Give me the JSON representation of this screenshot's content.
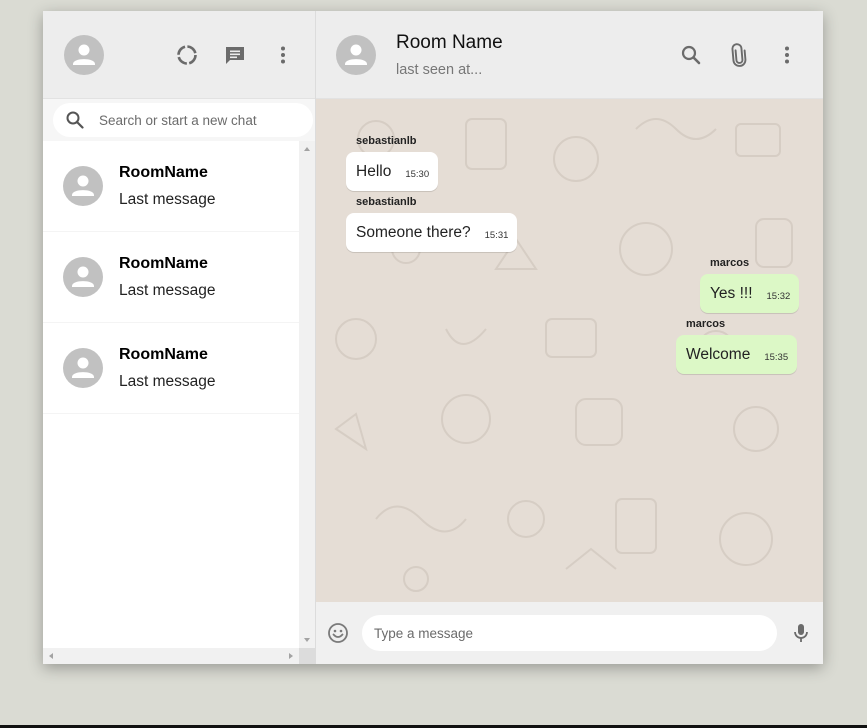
{
  "sidebar": {
    "search": {
      "placeholder": "Search or start a new chat"
    },
    "chats": [
      {
        "name": "RoomName",
        "last_message": "Last message"
      },
      {
        "name": "RoomName",
        "last_message": "Last message"
      },
      {
        "name": "RoomName",
        "last_message": "Last message"
      }
    ],
    "icons": [
      "avatar-icon",
      "status-icon",
      "chat-icon",
      "more-vert-icon"
    ]
  },
  "chat": {
    "header": {
      "room_name": "Room Name",
      "last_seen": "last seen at..."
    },
    "icons": [
      "search-icon",
      "attach-icon",
      "more-vert-icon"
    ],
    "messages": [
      {
        "author": "sebastianlb",
        "text": "Hello",
        "time": "15:30",
        "sent": false
      },
      {
        "author": "sebastianlb",
        "text": "Someone there?",
        "time": "15:31",
        "sent": false
      },
      {
        "author": "marcos",
        "text": "Yes !!!",
        "time": "15:32",
        "sent": true
      },
      {
        "author": "marcos",
        "text": "Welcome",
        "time": "15:35",
        "sent": true
      }
    ],
    "footer": {
      "placeholder": "Type a message",
      "icons": [
        "emoji-icon",
        "mic-icon"
      ]
    }
  },
  "colors": {
    "page_background": "#dadbd3",
    "header_background": "#ededed",
    "chat_background": "#e5ddd5",
    "sent_bubble": "#dcf8c6",
    "received_bubble": "#ffffff",
    "icon_grey": "#919191"
  }
}
